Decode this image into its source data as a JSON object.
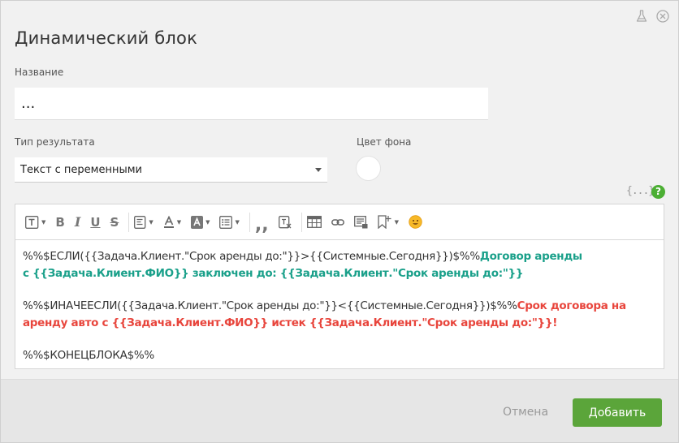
{
  "dialog": {
    "title": "Динамический блок"
  },
  "form": {
    "name_label": "Название",
    "name_value": "...",
    "type_label": "Тип результата",
    "type_selected": "Текст с переменными",
    "color_label": "Цвет фона",
    "color_value": "#ffffff"
  },
  "editor": {
    "variables_icon": "{...}",
    "help_icon": "?",
    "toolbar": [
      "text-format-icon",
      "bold-icon",
      "italic-icon",
      "underline-icon",
      "strikethrough-icon",
      "align-icon",
      "font-color-icon",
      "background-color-icon",
      "list-icon",
      "quote-icon",
      "clear-format-icon",
      "table-icon",
      "link-icon",
      "media-icon",
      "bookmark-icon",
      "emoji-icon"
    ],
    "lines": {
      "l1_plain": "%%$ЕСЛИ({{Задача.Клиент.\"Срок аренды до:\"}}>{{Системные.Сегодня}})$%%",
      "l1_green": "Договор аренды",
      "l2_green": "с {{Задача.Клиент.ФИО}} заключен до: {{Задача.Клиент.\"Срок аренды до:\"}}",
      "l3_plain": "%%$ИНАЧЕЕСЛИ({{Задача.Клиент.\"Срок аренды до:\"}}<{{Системные.Сегодня}})$%%",
      "l3_red": "Срок договора на",
      "l4_red": "аренду авто с {{Задача.Клиент.ФИО}} истек {{Задача.Клиент.\"Срок аренды до:\"}}!",
      "l5_plain": "%%$КОНЕЦБЛОКА$%%"
    }
  },
  "footer": {
    "cancel_label": "Отмена",
    "add_label": "Добавить"
  },
  "colors": {
    "accent_green": "#5ba53a",
    "text_green": "#1aa08a",
    "text_red": "#e8453c"
  }
}
